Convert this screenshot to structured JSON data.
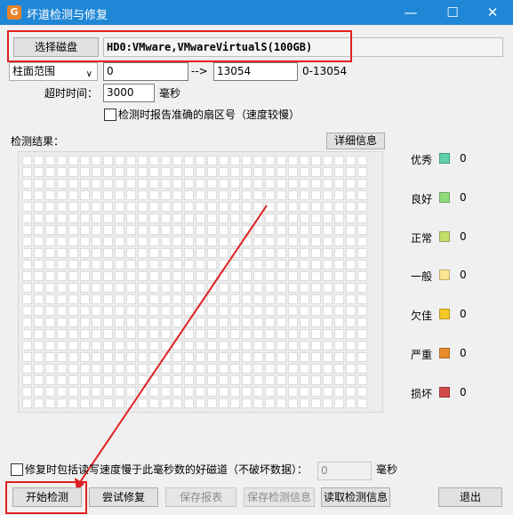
{
  "window": {
    "title": "坏道检测与修复"
  },
  "disk": {
    "select_label": "选择磁盘",
    "name": "HD0:VMware,VMwareVirtualS(100GB)"
  },
  "range": {
    "mode": "柱面范围",
    "start": "0",
    "arrow": "-->",
    "end": "13054",
    "hint": "0-13054"
  },
  "timeout": {
    "label": "超时时间：",
    "value": "3000",
    "unit": "毫秒"
  },
  "report_option": {
    "label": "检测时报告准确的扇区号（速度较慢）",
    "checked": false
  },
  "results": {
    "label": "检测结果：",
    "details_label": "详细信息"
  },
  "legend": [
    {
      "label": "优秀",
      "color": "#5fd0a7",
      "count": "0"
    },
    {
      "label": "良好",
      "color": "#8fdc7c",
      "count": "0"
    },
    {
      "label": "正常",
      "color": "#c3df6a",
      "count": "0"
    },
    {
      "label": "一般",
      "color": "#fbe594",
      "count": "0"
    },
    {
      "label": "欠佳",
      "color": "#f7c925",
      "count": "0"
    },
    {
      "label": "严重",
      "color": "#e98b2a",
      "count": "0"
    },
    {
      "label": "损坏",
      "color": "#d24a4a",
      "count": "0"
    }
  ],
  "repair_option": {
    "label": "修复时包括读写速度慢于此毫秒数的好磁道（不破坏数据）：",
    "value": "0",
    "unit": "毫秒",
    "checked": false
  },
  "actions": {
    "start": "开始检测",
    "repair": "尝试修复",
    "save_report": "保存报表",
    "save_info": "保存检测信息",
    "read_info": "读取检测信息",
    "exit": "退出"
  }
}
